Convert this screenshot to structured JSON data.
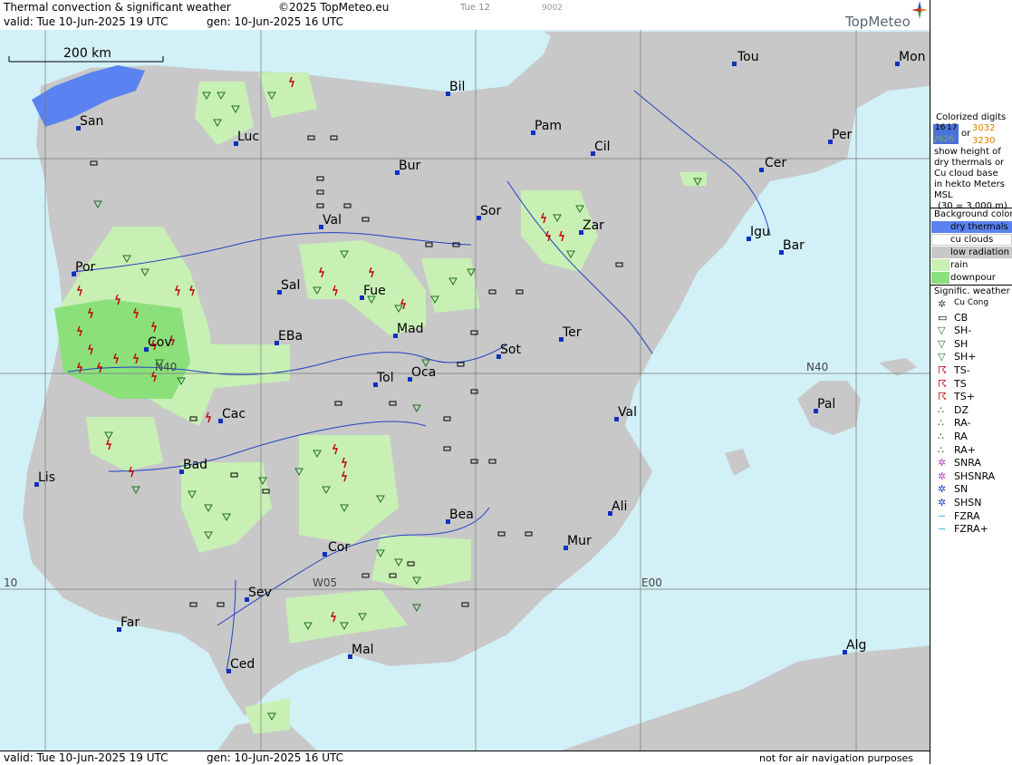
{
  "header": {
    "title": "Thermal convection & significant weather",
    "copyright": "©2025 TopMeteo.eu",
    "day": "Tue 12",
    "code": "9002",
    "valid": "valid:  Tue  10-Jun-2025  19 UTC",
    "gen": "gen: 10-Jun-2025 16 UTC",
    "brand": "TopMeteo"
  },
  "footer": {
    "valid": "valid:  Tue  10-Jun-2025  19 UTC",
    "gen": "gen: 10-Jun-2025 16 UTC",
    "note": "not for air navigation purposes"
  },
  "scale": {
    "label": "200 km"
  },
  "grid_labels": {
    "n40_left": "N40",
    "n40_right": "N40",
    "w10": "10",
    "w05": "W05",
    "e00": "E00"
  },
  "cities": [
    {
      "name": "Tou"
    },
    {
      "name": "Mon"
    },
    {
      "name": "Bil"
    },
    {
      "name": "San"
    },
    {
      "name": "Luc"
    },
    {
      "name": "Pam"
    },
    {
      "name": "Per"
    },
    {
      "name": "Cil"
    },
    {
      "name": "Bur"
    },
    {
      "name": "Cer"
    },
    {
      "name": "Val"
    },
    {
      "name": "Sor"
    },
    {
      "name": "Zar"
    },
    {
      "name": "Igu"
    },
    {
      "name": "Bar"
    },
    {
      "name": "Por"
    },
    {
      "name": "Sal"
    },
    {
      "name": "Fue"
    },
    {
      "name": "Cov"
    },
    {
      "name": "EBa"
    },
    {
      "name": "Mad"
    },
    {
      "name": "Ter"
    },
    {
      "name": "Sot"
    },
    {
      "name": "Tol"
    },
    {
      "name": "Oca"
    },
    {
      "name": "Pal"
    },
    {
      "name": "Cac"
    },
    {
      "name": "Val"
    },
    {
      "name": "Lis"
    },
    {
      "name": "Bad"
    },
    {
      "name": "Bea"
    },
    {
      "name": "Ali"
    },
    {
      "name": "Cor"
    },
    {
      "name": "Mur"
    },
    {
      "name": "Sev"
    },
    {
      "name": "Far"
    },
    {
      "name": "Mal"
    },
    {
      "name": "Alg"
    },
    {
      "name": "Ced"
    }
  ],
  "legend": {
    "colorized_title": "Colorized digits",
    "sample_a": "16",
    "sample_b": "17",
    "sample_c": "2626",
    "or": "or",
    "sample_d": "3032",
    "sample_e": "3230",
    "desc1": "show height of",
    "desc2": "dry thermals or",
    "desc3": "Cu cloud base",
    "desc4": "in hekto Meters",
    "desc5": "MSL",
    "desc6": "(30 = 3,000 m)",
    "background_title": "Background color",
    "bg_items": [
      {
        "label": "dry thermals",
        "color": "#5a82f0"
      },
      {
        "label": "cu clouds",
        "color": "#ffffff"
      },
      {
        "label": "low radiation",
        "color": "#c8c8c8"
      },
      {
        "label": "rain",
        "color": "#c8f0b4"
      },
      {
        "label": "downpour",
        "color": "#8ce07c"
      }
    ],
    "sigwx_title": "Signific. weather",
    "sigwx_items": [
      {
        "label": "Cu Cong",
        "icon": "cu-cong-icon"
      },
      {
        "label": "CB",
        "icon": "cb-icon"
      },
      {
        "label": "SH-",
        "icon": "sh-light-icon"
      },
      {
        "label": "SH",
        "icon": "sh-icon"
      },
      {
        "label": "SH+",
        "icon": "sh-heavy-icon"
      },
      {
        "label": "TS-",
        "icon": "ts-light-icon"
      },
      {
        "label": "TS",
        "icon": "ts-icon"
      },
      {
        "label": "TS+",
        "icon": "ts-heavy-icon"
      },
      {
        "label": "DZ",
        "icon": "drizzle-icon"
      },
      {
        "label": "RA-",
        "icon": "rain-light-icon"
      },
      {
        "label": "RA",
        "icon": "rain-icon"
      },
      {
        "label": "RA+",
        "icon": "rain-heavy-icon"
      },
      {
        "label": "SNRA",
        "icon": "snow-rain-icon"
      },
      {
        "label": "SHSNRA",
        "icon": "shower-snow-rain-icon"
      },
      {
        "label": "SN",
        "icon": "snow-icon"
      },
      {
        "label": "SHSN",
        "icon": "shower-snow-icon"
      },
      {
        "label": "FZRA",
        "icon": "freezing-rain-icon"
      },
      {
        "label": "FZRA+",
        "icon": "freezing-rain-heavy-icon"
      }
    ]
  },
  "colors": {
    "sea": "#d2f0f7",
    "land": "#c8c8c8",
    "rain": "#c8f0b4",
    "downpour": "#8ce07c",
    "dry": "#5a82f0",
    "river": "#2040c0",
    "city": "#1030c0",
    "ts": "#c00000"
  }
}
